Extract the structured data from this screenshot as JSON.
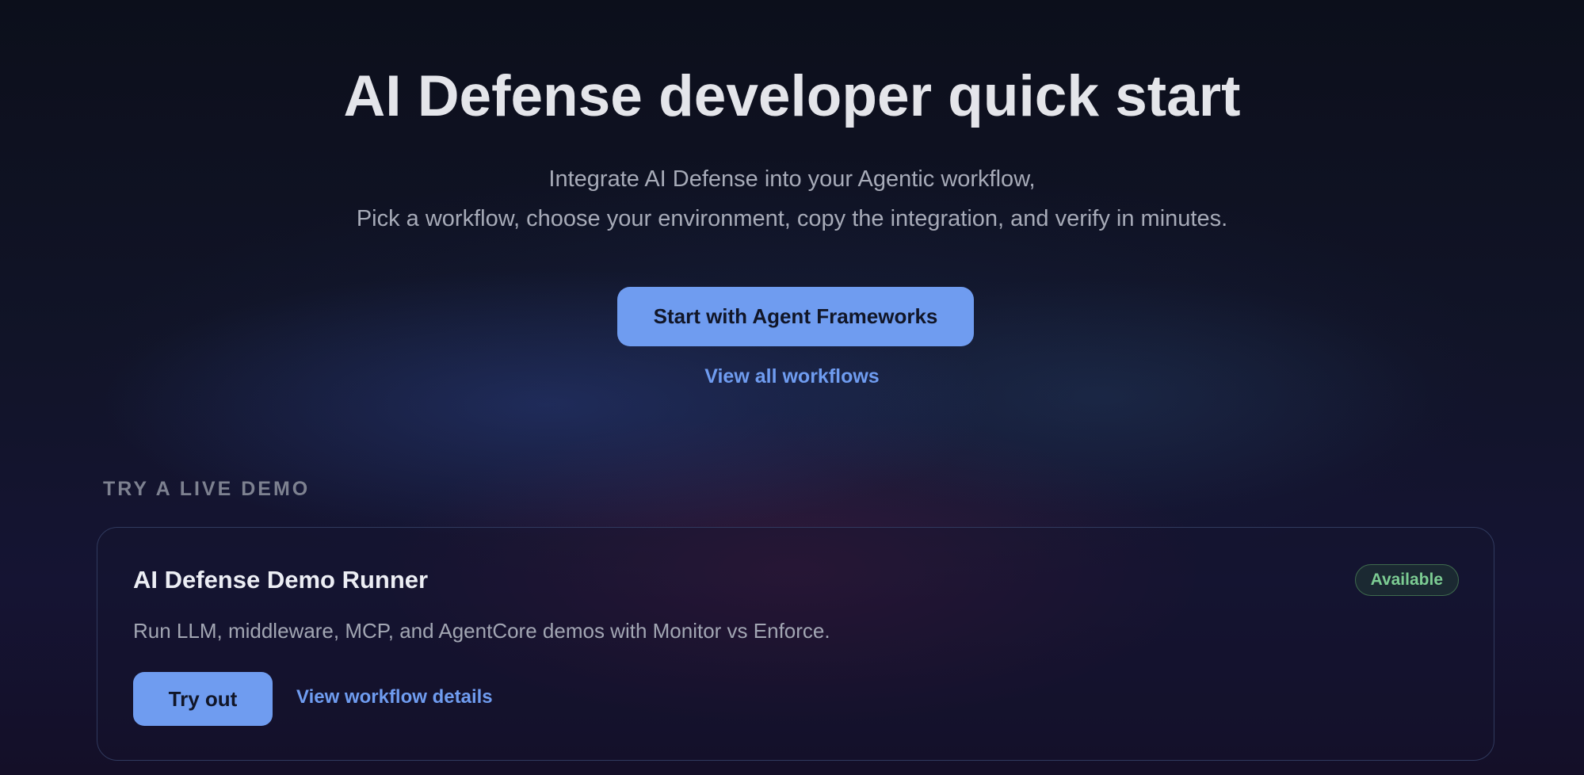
{
  "hero": {
    "title": "AI Defense developer quick start",
    "subtitle_line1": "Integrate AI Defense into your Agentic workflow,",
    "subtitle_line2": "Pick a workflow, choose your environment, copy the integration, and verify in minutes.",
    "primary_button_label": "Start with Agent Frameworks",
    "secondary_link_label": "View all workflows"
  },
  "demo_section": {
    "label": "TRY A LIVE DEMO",
    "card": {
      "title": "AI Defense Demo Runner",
      "badge": "Available",
      "description": "Run LLM, middleware, MCP, and AgentCore demos with Monitor vs Enforce.",
      "primary_button_label": "Try out",
      "secondary_link_label": "View workflow details"
    }
  },
  "colors": {
    "accent": "#6f9cf0",
    "badge_green": "#7ccc93",
    "background": "#0d0f1c"
  }
}
